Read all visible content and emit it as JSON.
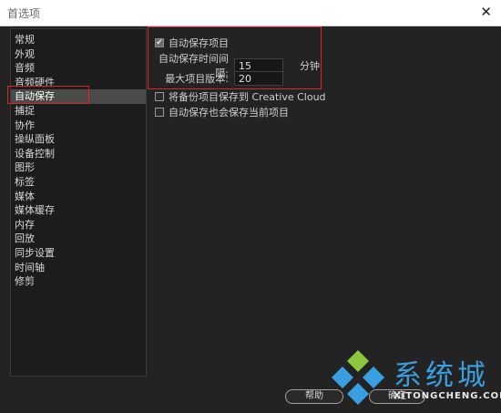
{
  "window": {
    "title": "首选项",
    "close_symbol": "✕"
  },
  "sidebar": {
    "items": [
      {
        "label": "常规"
      },
      {
        "label": "外观"
      },
      {
        "label": "音频"
      },
      {
        "label": "音频硬件"
      },
      {
        "label": "自动保存",
        "selected": true
      },
      {
        "label": "捕捉"
      },
      {
        "label": "协作"
      },
      {
        "label": "操纵面板"
      },
      {
        "label": "设备控制"
      },
      {
        "label": "图形"
      },
      {
        "label": "标签"
      },
      {
        "label": "媒体"
      },
      {
        "label": "媒体缓存"
      },
      {
        "label": "内存"
      },
      {
        "label": "回放"
      },
      {
        "label": "同步设置"
      },
      {
        "label": "时间轴"
      },
      {
        "label": "修剪"
      }
    ]
  },
  "autosave": {
    "enable_label": "自动保存项目",
    "enable_checked": true,
    "interval_label": "自动保存时间间隔:",
    "interval_value": "15",
    "interval_unit": "分钟",
    "max_versions_label": "最大项目版本:",
    "max_versions_value": "20",
    "backup_cloud_label": "将备份项目保存到 Creative Cloud",
    "backup_cloud_checked": false,
    "save_current_label": "自动保存也会保存当前项目",
    "save_current_checked": false
  },
  "footer": {
    "help_label": "帮助",
    "ok_label": "确定"
  },
  "watermark": {
    "text": "系统城",
    "sub": "XITONGCHENG.COM"
  },
  "colors": {
    "highlight_border": "#e0222b",
    "watermark_blue": "#3a9fe0",
    "watermark_green": "#8cc63f"
  }
}
